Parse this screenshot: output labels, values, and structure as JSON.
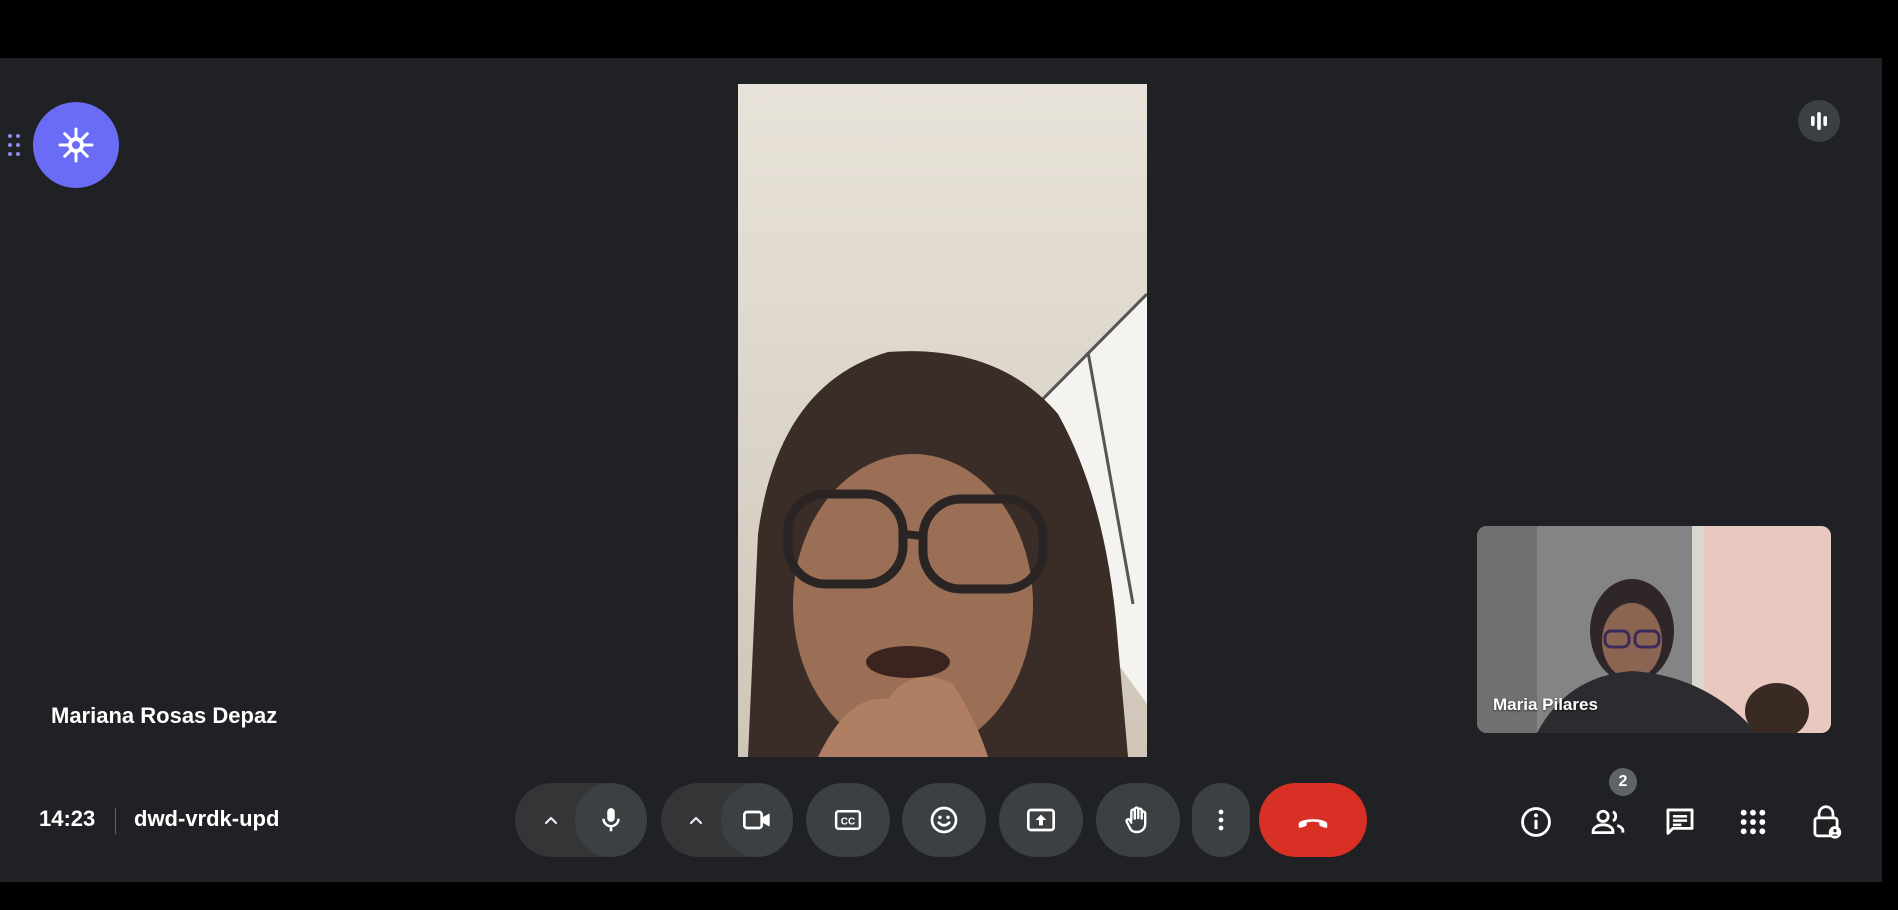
{
  "participants": {
    "main": {
      "name": "Mariana Rosas Depaz"
    },
    "self": {
      "name": "Maria Pilares"
    }
  },
  "meeting": {
    "time": "14:23",
    "code": "dwd-vrdk-upd"
  },
  "people": {
    "count": "2"
  },
  "icons": {
    "drag": "drag-handle-icon",
    "ai": "sparkle-icon",
    "speaking": "audio-level-icon",
    "mic": "microphone-icon",
    "camera": "videocam-icon",
    "captions": "closed-captions-icon",
    "reactions": "emoji-icon",
    "present": "present-screen-icon",
    "hand": "raise-hand-icon",
    "more": "more-vert-icon",
    "end": "call-end-icon",
    "info": "info-icon",
    "people": "people-icon",
    "chat": "chat-icon",
    "activities": "apps-icon",
    "host": "host-controls-icon"
  },
  "colors": {
    "accent": "#6a6cf6",
    "end_call": "#d93025",
    "background": "#202124",
    "button": "#3c4043"
  }
}
